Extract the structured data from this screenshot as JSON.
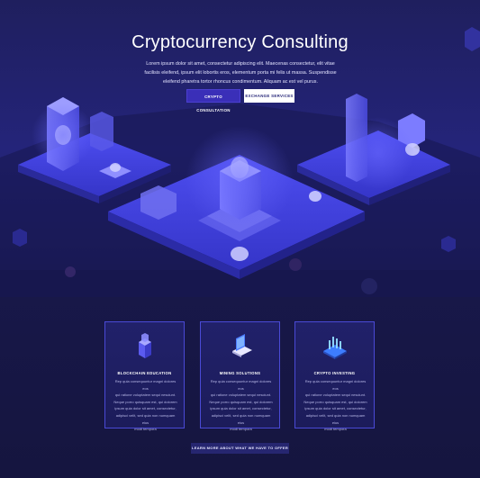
{
  "hero": {
    "title": "Cryptocurrency Consulting",
    "subtitle_lines": [
      "Lorem ipsum dolor sit amet, consectetur adipiscing elit. Maecenas consectetur, elit vitae",
      "facilisis eleifend, ipsum elit lobortis eros, elementum porta mi felis ut massa. Suspendisse",
      "eleifend pharetra tortor rhoncus condimentum. Aliquam ac est vel purus."
    ],
    "primary_button": "CRYPTO CONSULTATION",
    "secondary_button": "EXCHANGE SERVICES"
  },
  "features": [
    {
      "icon": "blockchain-cube-icon",
      "title": "BLOCKCHAIN EDUCATION",
      "body_lines": [
        "Rep quia consequuntur magni dolores eos",
        "qui ratione voluptatem sequi nesciunt.",
        "Neque porro quisquam est, qui dolorem",
        "ipsum quia dolor sit amet, consectetur,",
        "adipisci velit, sed quia non numquam eius",
        "modi tempora"
      ]
    },
    {
      "icon": "laptop-mining-icon",
      "title": "MINING SOLUTIONS",
      "body_lines": [
        "Rep quia consequuntur magni dolores eos",
        "qui ratione voluptatem sequi nesciunt.",
        "Neque porro quisquam est, qui dolorem",
        "ipsum quia dolor sit amet, consectetur,",
        "adipisci velit, sed quia non numquam eius",
        "modi tempora"
      ]
    },
    {
      "icon": "investing-chart-icon",
      "title": "CRYPTO INVESTING",
      "body_lines": [
        "Rep quia consequuntur magni dolores eos",
        "qui ratione voluptatem sequi nesciunt.",
        "Neque porro quisquam est, qui dolorem",
        "ipsum quia dolor sit amet, consectetur,",
        "adipisci velit, sed quia non numquam eius",
        "modi tempora"
      ]
    }
  ],
  "cta": "LEARN MORE ABOUT WHAT WE HAVE TO OFFER",
  "colors": {
    "background": "#1a1a4c",
    "accent": "#3a2fb8",
    "card_border": "#4a4ad6"
  }
}
